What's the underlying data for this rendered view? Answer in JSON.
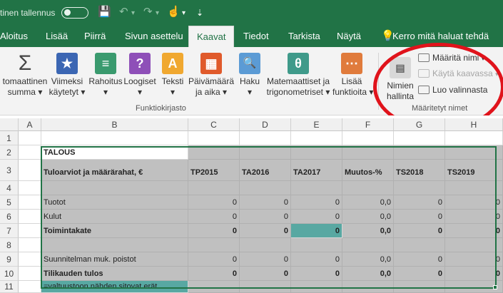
{
  "titlebar": {
    "autosave_label": "tinen tallennus",
    "save_icon": "💾",
    "undo_icon": "↶",
    "redo_icon": "↷",
    "touch_icon": "☝",
    "dropdown_mark": "▾",
    "customize_mark": "⇣"
  },
  "tabs": [
    {
      "label": "Aloitus"
    },
    {
      "label": "Lisää"
    },
    {
      "label": "Piirrä"
    },
    {
      "label": "Sivun asettelu"
    },
    {
      "label": "Kaavat"
    },
    {
      "label": "Tiedot"
    },
    {
      "label": "Tarkista"
    },
    {
      "label": "Näytä"
    },
    {
      "label": "Kerro mitä haluat tehdä"
    }
  ],
  "ribbon": {
    "function_library": {
      "group_label": "Funktiokirjasto",
      "buttons": [
        {
          "label": "tomaattinen\nsumma ▾",
          "icon": "Σ",
          "color": "#f3f3f3"
        },
        {
          "label": "Viimeksi\nkäytetyt ▾",
          "icon": "★",
          "color": "#3b66b3"
        },
        {
          "label": "Rahoitus\n▾",
          "icon": "≡",
          "color": "#3a9a6e"
        },
        {
          "label": "Loogiset\n▾",
          "icon": "?",
          "color": "#8e4fb8"
        },
        {
          "label": "Teksti\n▾",
          "icon": "A",
          "color": "#f0a830"
        },
        {
          "label": "Päivämäärä\nja aika ▾",
          "icon": "▦",
          "color": "#e05a2b"
        },
        {
          "label": "Haku\n▾",
          "icon": "🔍",
          "color": "#5b9bd5"
        },
        {
          "label": "Matemaattiset ja\ntrigonometriset ▾",
          "icon": "θ",
          "color": "#3f9a8a"
        },
        {
          "label": "Lisää\nfunktioita ▾",
          "icon": "⋯",
          "color": "#e07b3c"
        }
      ]
    },
    "defined_names": {
      "group_label": "Määritetyt nimet",
      "name_manager_label": "Nimien\nhallinta",
      "define_name_label": "Määritä nimi",
      "use_in_formula_label": "Käytä kaavassa",
      "create_from_selection_label": "Luo valinnasta"
    }
  },
  "grid": {
    "columns": [
      "A",
      "B",
      "C",
      "D",
      "E",
      "F",
      "G",
      "H"
    ],
    "rows": [
      {
        "num": "1",
        "cells": [
          "",
          "",
          "",
          "",
          "",
          "",
          "",
          ""
        ]
      },
      {
        "num": "2",
        "cells": [
          "",
          "TALOUS",
          "",
          "",
          "",
          "",
          "",
          ""
        ]
      },
      {
        "num": "3",
        "cells": [
          "",
          "Tuloarviot ja määrärahat, €",
          "TP2015",
          "TA2016",
          "TA2017",
          "Muutos-%",
          "TS2018",
          "TS2019"
        ]
      },
      {
        "num": "4",
        "cells": [
          "",
          "",
          "",
          "",
          "",
          "",
          "",
          ""
        ]
      },
      {
        "num": "5",
        "cells": [
          "",
          "Tuotot",
          "0",
          "0",
          "0",
          "0,0",
          "0",
          "0"
        ]
      },
      {
        "num": "6",
        "cells": [
          "",
          "Kulut",
          "0",
          "0",
          "0",
          "0,0",
          "0",
          "0"
        ]
      },
      {
        "num": "7",
        "cells": [
          "",
          "Toimintakate",
          "0",
          "0",
          "0",
          "0,0",
          "0",
          "0"
        ]
      },
      {
        "num": "8",
        "cells": [
          "",
          "",
          "",
          "",
          "",
          "",
          "",
          ""
        ]
      },
      {
        "num": "9",
        "cells": [
          "",
          "Suunnitelman muk. poistot",
          "0",
          "0",
          "0",
          "0,0",
          "0",
          "0"
        ]
      },
      {
        "num": "10",
        "cells": [
          "",
          "Tilikauden tulos",
          "0",
          "0",
          "0",
          "0,0",
          "0",
          "0"
        ]
      },
      {
        "num": "11",
        "cells": [
          "",
          "=valtuustoon nähden sitovat erät",
          "",
          "",
          "",
          "",
          "",
          ""
        ]
      }
    ]
  }
}
